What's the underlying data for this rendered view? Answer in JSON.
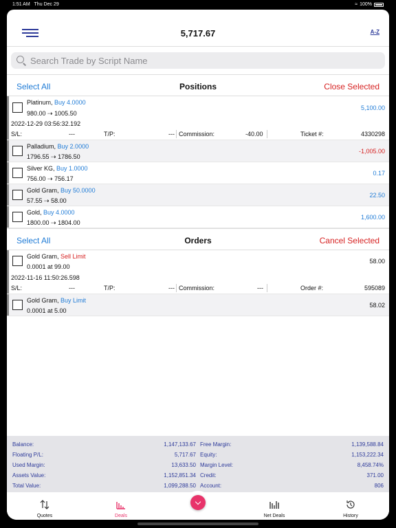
{
  "status": {
    "time": "1:51 AM",
    "date": "Thu Dec 29",
    "battery": "100%"
  },
  "header": {
    "title": "5,717.67",
    "sort_icon": "A-Z"
  },
  "search": {
    "placeholder": "Search Trade by Script Name"
  },
  "positions": {
    "select_all": "Select All",
    "title": "Positions",
    "close_selected": "Close Selected",
    "items": [
      {
        "symbol": "Platinum,",
        "side": "Buy 4.0000",
        "prices": "980.00 ⇢ 1005.50",
        "value": "5,100.00",
        "timestamp": "2022-12-29 03:56:32.192",
        "sl_label": "S/L:",
        "sl_value": "---",
        "tp_label": "T/P:",
        "tp_value": "---",
        "commission_label": "Commission:",
        "commission_value": "-40.00",
        "ticket_label": "Ticket #:",
        "ticket_value": "4330298"
      },
      {
        "symbol": "Palladium,",
        "side": "Buy 2.0000",
        "prices": "1796.55 ⇢ 1786.50",
        "value": "-1,005.00"
      },
      {
        "symbol": "Silver KG,",
        "side": "Buy 1.0000",
        "prices": "756.00 ⇢ 756.17",
        "value": "0.17"
      },
      {
        "symbol": "Gold Gram,",
        "side": "Buy 50.0000",
        "prices": "57.55 ⇢ 58.00",
        "value": "22.50"
      },
      {
        "symbol": "Gold,",
        "side": "Buy 4.0000",
        "prices": "1800.00 ⇢ 1804.00",
        "value": "1,600.00"
      }
    ]
  },
  "orders": {
    "select_all": "Select All",
    "title": "Orders",
    "cancel_selected": "Cancel Selected",
    "items": [
      {
        "symbol": "Gold Gram,",
        "side": "Sell Limit",
        "prices": "0.0001 at 99.00",
        "value": "58.00",
        "timestamp": "2022-11-16 11:50:26.598",
        "sl_label": "S/L:",
        "sl_value": "---",
        "tp_label": "T/P:",
        "tp_value": "---",
        "commission_label": "Commission:",
        "commission_value": "---",
        "ticket_label": "Order #:",
        "ticket_value": "595089"
      },
      {
        "symbol": "Gold Gram,",
        "side": "Buy Limit",
        "prices": "0.0001 at 5.00",
        "value": "58.02"
      }
    ]
  },
  "summary": {
    "balance_label": "Balance:",
    "balance": "1,147,133.67",
    "free_margin_label": "Free Margin:",
    "free_margin": "1,139,588.84",
    "floating_label": "Floating P/L:",
    "floating": "5,717.67",
    "equity_label": "Equity:",
    "equity": "1,153,222.34",
    "used_margin_label": "Used Margin:",
    "used_margin": "13,633.50",
    "margin_level_label": "Margin Level:",
    "margin_level": "8,458.74%",
    "assets_label": "Assets Value:",
    "assets": "1,152,851.34",
    "credit_label": "Credit:",
    "credit": "371.00",
    "total_label": "Total Value:",
    "total": "1,099,288.50",
    "account_label": "Account:",
    "account": "806"
  },
  "tabs": {
    "quotes": "Quotes",
    "deals": "Deals",
    "net_deals": "Net Deals",
    "history": "History"
  },
  "colors": {
    "accent_blue": "#1f7bd6",
    "negative_red": "#d62020",
    "active_pink": "#e8336a",
    "navy": "#2d3a9a"
  }
}
